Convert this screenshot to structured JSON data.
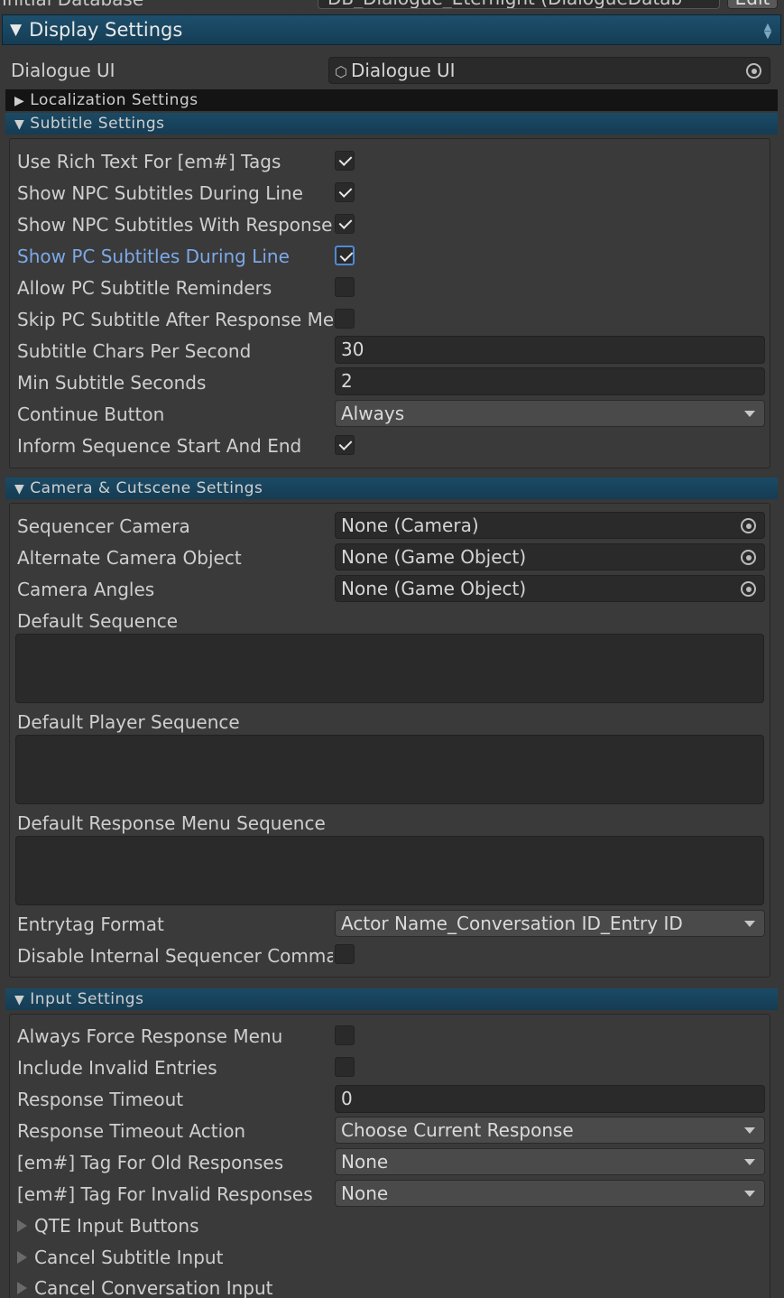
{
  "top_row": {
    "label": "Initial Database",
    "value": "DB_Dialogue_Eternight (DialogueDatab",
    "edit_label": "Edit"
  },
  "display_settings": {
    "title": "Display Settings"
  },
  "dialogue_ui": {
    "label": "Dialogue UI",
    "value": "Dialogue UI"
  },
  "localization": {
    "title": "Localization Settings"
  },
  "subtitle": {
    "title": "Subtitle Settings",
    "use_rich_text": {
      "label": "Use Rich Text For [em#] Tags",
      "checked": true
    },
    "show_npc_during": {
      "label": "Show NPC Subtitles During Line",
      "checked": true
    },
    "show_npc_with_responses": {
      "label": "Show NPC Subtitles With Responses",
      "checked": true
    },
    "show_pc_during": {
      "label": "Show PC Subtitles During Line",
      "checked": true
    },
    "allow_pc_reminders": {
      "label": "Allow PC Subtitle Reminders",
      "checked": false
    },
    "skip_pc_after_menu": {
      "label": "Skip PC Subtitle After Response Menu",
      "checked": false
    },
    "chars_per_second": {
      "label": "Subtitle Chars Per Second",
      "value": "30"
    },
    "min_seconds": {
      "label": "Min Subtitle Seconds",
      "value": "2"
    },
    "continue_button": {
      "label": "Continue Button",
      "value": "Always"
    },
    "inform_sequence": {
      "label": "Inform Sequence Start And End",
      "checked": true
    }
  },
  "camera": {
    "title": "Camera & Cutscene Settings",
    "sequencer_camera": {
      "label": "Sequencer Camera",
      "value": "None (Camera)"
    },
    "alternate_camera": {
      "label": "Alternate Camera Object",
      "value": "None (Game Object)"
    },
    "camera_angles": {
      "label": "Camera Angles",
      "value": "None (Game Object)"
    },
    "default_sequence": {
      "label": "Default Sequence"
    },
    "default_player_sequence": {
      "label": "Default Player Sequence"
    },
    "default_response_menu_sequence": {
      "label": "Default Response Menu Sequence"
    },
    "entrytag_format": {
      "label": "Entrytag Format",
      "value": "Actor Name_Conversation ID_Entry ID"
    },
    "disable_internal": {
      "label": "Disable Internal Sequencer Commands",
      "checked": false
    }
  },
  "input": {
    "title": "Input Settings",
    "always_force_menu": {
      "label": "Always Force Response Menu",
      "checked": false
    },
    "include_invalid": {
      "label": "Include Invalid Entries",
      "checked": false
    },
    "response_timeout": {
      "label": "Response Timeout",
      "value": "0"
    },
    "timeout_action": {
      "label": "Response Timeout Action",
      "value": "Choose Current Response"
    },
    "tag_old": {
      "label": "[em#] Tag For Old Responses",
      "value": "None"
    },
    "tag_invalid": {
      "label": "[em#] Tag For Invalid Responses",
      "value": "None"
    },
    "qte_buttons": {
      "label": "QTE Input Buttons"
    },
    "cancel_subtitle": {
      "label": "Cancel Subtitle Input"
    },
    "cancel_conversation": {
      "label": "Cancel Conversation Input"
    }
  }
}
